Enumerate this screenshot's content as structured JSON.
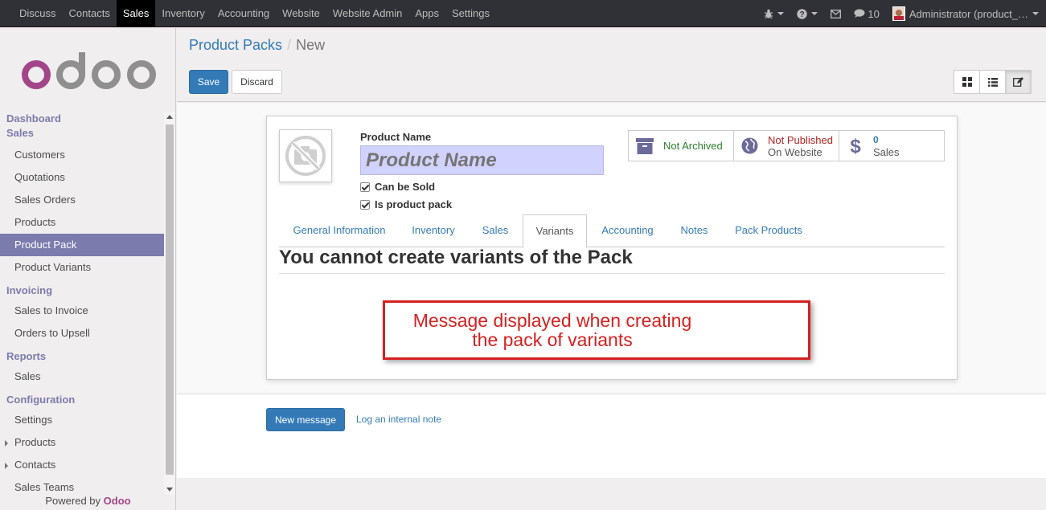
{
  "topbar": {
    "menu": [
      {
        "label": "Discuss",
        "active": false
      },
      {
        "label": "Contacts",
        "active": false
      },
      {
        "label": "Sales",
        "active": true
      },
      {
        "label": "Inventory",
        "active": false
      },
      {
        "label": "Accounting",
        "active": false
      },
      {
        "label": "Website",
        "active": false
      },
      {
        "label": "Website Admin",
        "active": false
      },
      {
        "label": "Apps",
        "active": false
      },
      {
        "label": "Settings",
        "active": false
      }
    ],
    "messages_count": "10",
    "user_label": "Administrator (product_…"
  },
  "sidebar": {
    "sections": [
      {
        "title": "Dashboard",
        "items": []
      },
      {
        "title": "Sales",
        "items": [
          {
            "label": "Customers",
            "active": false,
            "expandable": false
          },
          {
            "label": "Quotations",
            "active": false,
            "expandable": false
          },
          {
            "label": "Sales Orders",
            "active": false,
            "expandable": false
          },
          {
            "label": "Products",
            "active": false,
            "expandable": false
          },
          {
            "label": "Product Pack",
            "active": true,
            "expandable": false
          },
          {
            "label": "Product Variants",
            "active": false,
            "expandable": false
          }
        ]
      },
      {
        "title": "Invoicing",
        "items": [
          {
            "label": "Sales to Invoice",
            "active": false,
            "expandable": false
          },
          {
            "label": "Orders to Upsell",
            "active": false,
            "expandable": false
          }
        ]
      },
      {
        "title": "Reports",
        "items": [
          {
            "label": "Sales",
            "active": false,
            "expandable": false
          }
        ]
      },
      {
        "title": "Configuration",
        "items": [
          {
            "label": "Settings",
            "active": false,
            "expandable": false
          },
          {
            "label": "Products",
            "active": false,
            "expandable": true
          },
          {
            "label": "Contacts",
            "active": false,
            "expandable": true
          },
          {
            "label": "Sales Teams",
            "active": false,
            "expandable": false
          }
        ]
      }
    ],
    "powered_by": "Powered by",
    "powered_brand": "Odoo"
  },
  "control_panel": {
    "breadcrumb_parent": "Product Packs",
    "breadcrumb_separator": "/",
    "breadcrumb_current": "New",
    "save_label": "Save",
    "discard_label": "Discard"
  },
  "form": {
    "product_name_label": "Product Name",
    "product_name_placeholder": "Product Name",
    "can_be_sold_label": "Can be Sold",
    "is_product_pack_label": "Is product pack",
    "stat_archived": "Not Archived",
    "stat_published_line1": "Not Published",
    "stat_published_line2": "On Website",
    "stat_sales_count": "0",
    "stat_sales_label": "Sales",
    "tabs": [
      {
        "label": "General Information",
        "active": false
      },
      {
        "label": "Inventory",
        "active": false
      },
      {
        "label": "Sales",
        "active": false
      },
      {
        "label": "Variants",
        "active": true
      },
      {
        "label": "Accounting",
        "active": false
      },
      {
        "label": "Notes",
        "active": false
      },
      {
        "label": "Pack Products",
        "active": false
      }
    ],
    "variants_message": "You cannot create variants of the Pack"
  },
  "annotation": {
    "line1": "Message displayed when creating",
    "line2": "the pack of variants"
  },
  "chatter": {
    "new_message_label": "New message",
    "log_note_label": "Log an internal note"
  },
  "colors": {
    "brand_purple": "#7c7bad",
    "primary_blue": "#337ab7",
    "annotation_red": "#d62020",
    "archived_green": "#2b7d2b",
    "unpublished_red": "#b22222"
  }
}
